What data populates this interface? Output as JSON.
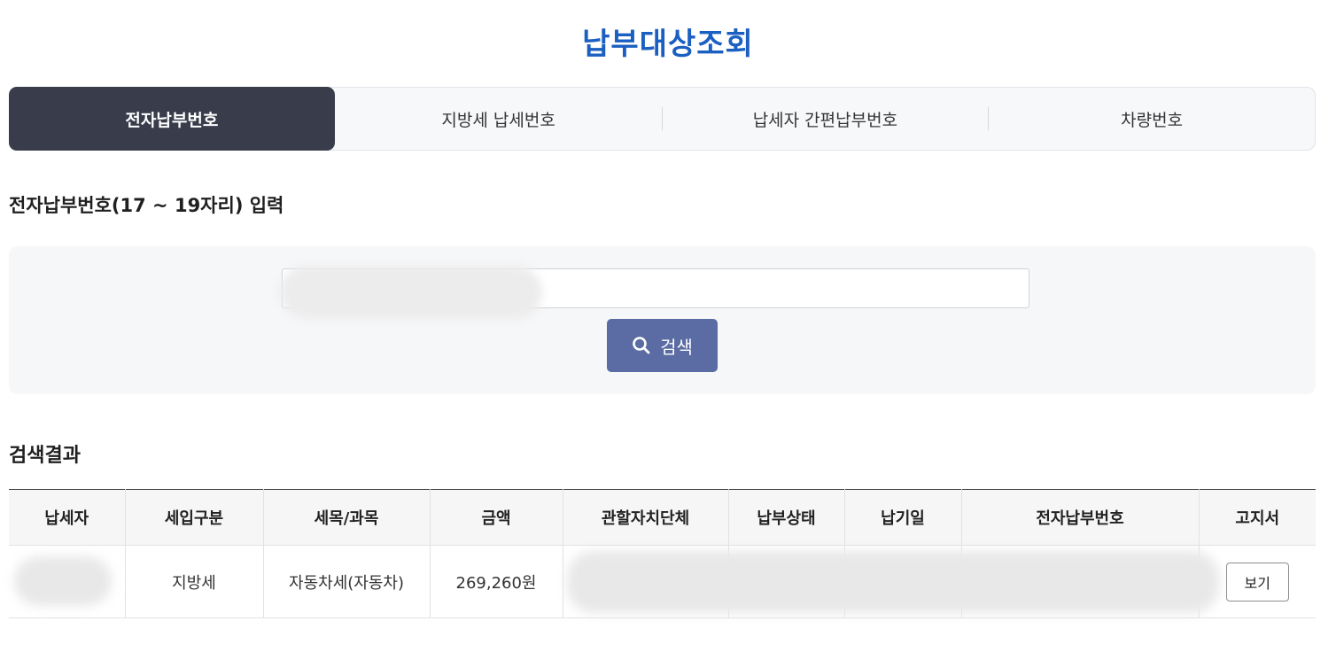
{
  "page": {
    "title": "납부대상조회"
  },
  "tabs": [
    {
      "label": "전자납부번호",
      "active": true
    },
    {
      "label": "지방세 납세번호",
      "active": false
    },
    {
      "label": "납세자 간편납부번호",
      "active": false
    },
    {
      "label": "차량번호",
      "active": false
    }
  ],
  "search": {
    "heading": "전자납부번호(17 ~ 19자리) 입력",
    "input_value": "",
    "button_label": "검색",
    "button_icon": "search-icon"
  },
  "results": {
    "heading": "검색결과",
    "columns": [
      "납세자",
      "세입구분",
      "세목/과목",
      "금액",
      "관할자치단체",
      "납부상태",
      "납기일",
      "전자납부번호",
      "고지서"
    ],
    "rows": [
      {
        "taxpayer": "",
        "revenue_type": "지방세",
        "tax_item": "자동차세(자동차)",
        "amount": "269,260원",
        "jurisdiction": "",
        "payment_status": "",
        "due_date": "",
        "electronic_payment_no": "",
        "notice_button": "보기"
      }
    ]
  },
  "colors": {
    "title": "#1a5fc1",
    "active_tab": "#393c4b",
    "search_button": "#5a6ca3"
  }
}
